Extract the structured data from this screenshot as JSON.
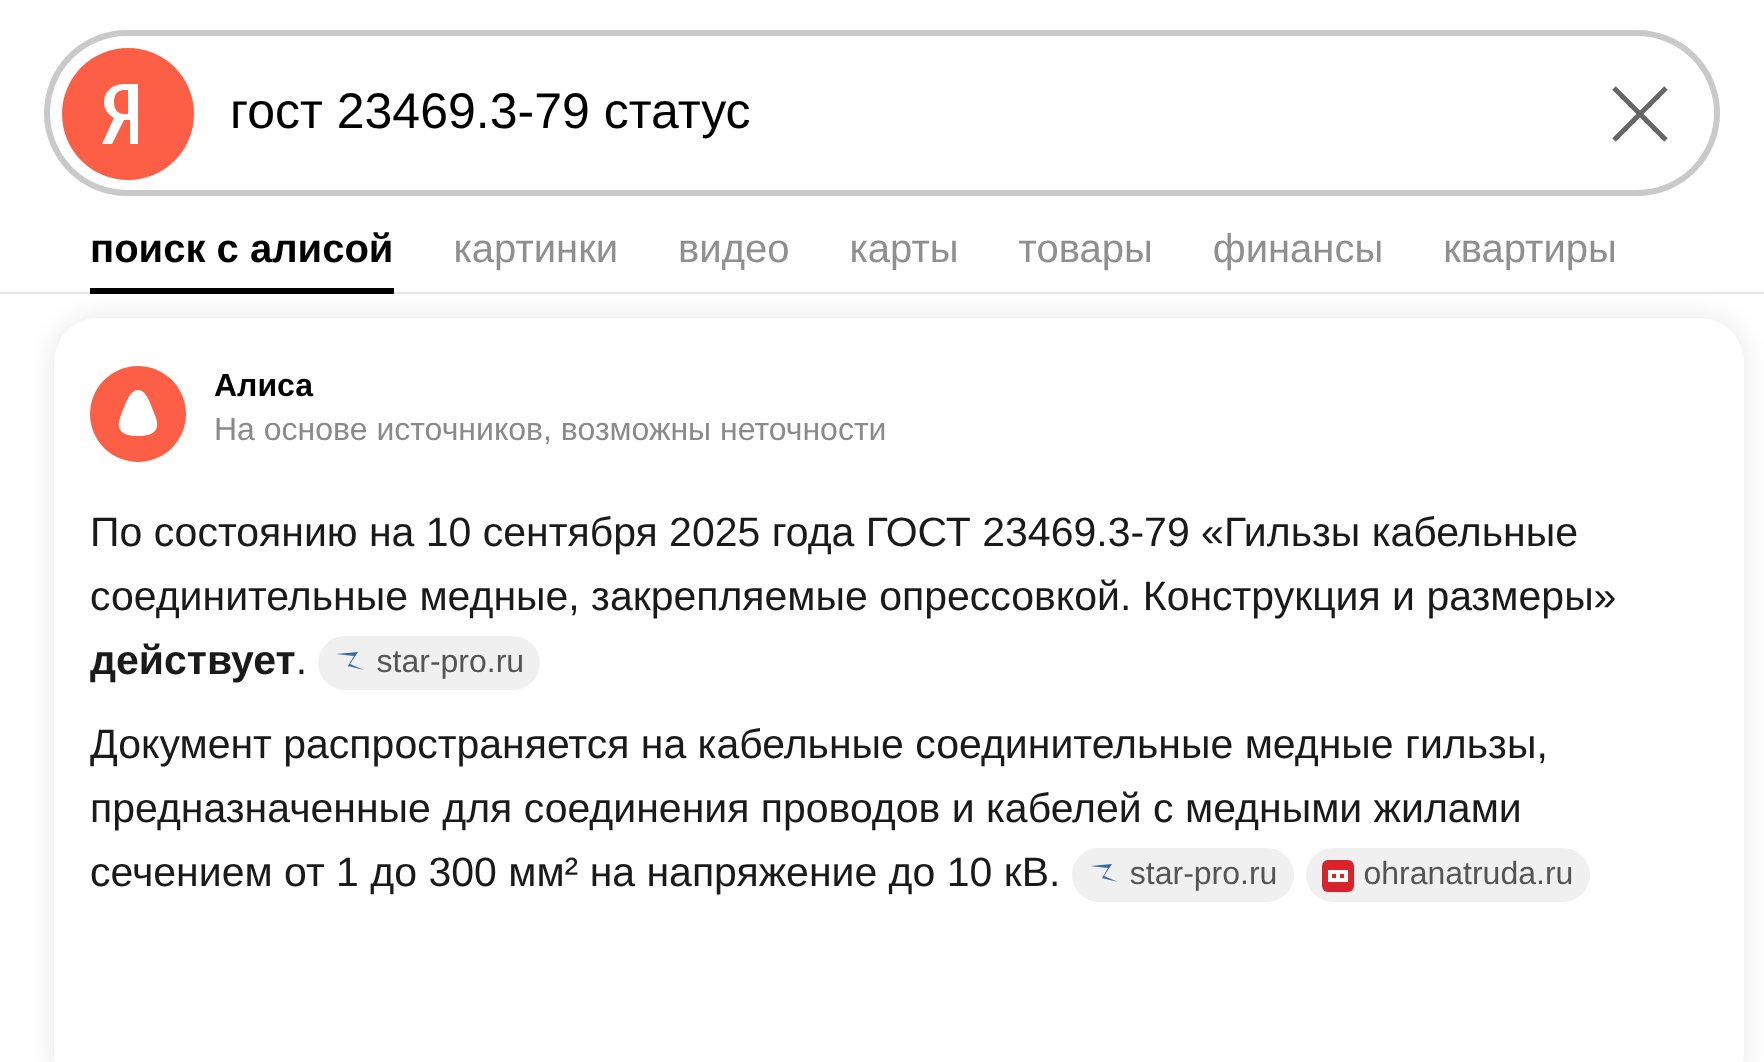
{
  "search": {
    "value": "гост 23469.3-79 статус"
  },
  "tabs": [
    {
      "label": "поиск с алисой",
      "selected": true
    },
    {
      "label": "картинки",
      "selected": false
    },
    {
      "label": "видео",
      "selected": false
    },
    {
      "label": "карты",
      "selected": false
    },
    {
      "label": "товары",
      "selected": false
    },
    {
      "label": "финансы",
      "selected": false
    },
    {
      "label": "квартиры",
      "selected": false
    }
  ],
  "answer": {
    "author": "Алиса",
    "disclaimer": "На основе источников, возможны неточности",
    "paragraphs": [
      {
        "text": "По состоянию на 10 сентября 2025 года ГОСТ 23469.3-79 «Гильзы кабельные соединительные медные, закрепляемые опрессовкой. Конструкция и размеры» **действует**.",
        "sources": [
          {
            "label": "star-pro.ru",
            "kind": "star"
          }
        ]
      },
      {
        "text": "Документ распространяется на кабельные соединительные медные гильзы, предназначенные для соединения проводов и кабелей с медными жилами сечением от 1 до 300 мм² на напряжение до 10 кВ.",
        "sources": [
          {
            "label": "star-pro.ru",
            "kind": "star"
          },
          {
            "label": "ohranatruda.ru",
            "kind": "ot"
          }
        ]
      }
    ]
  }
}
